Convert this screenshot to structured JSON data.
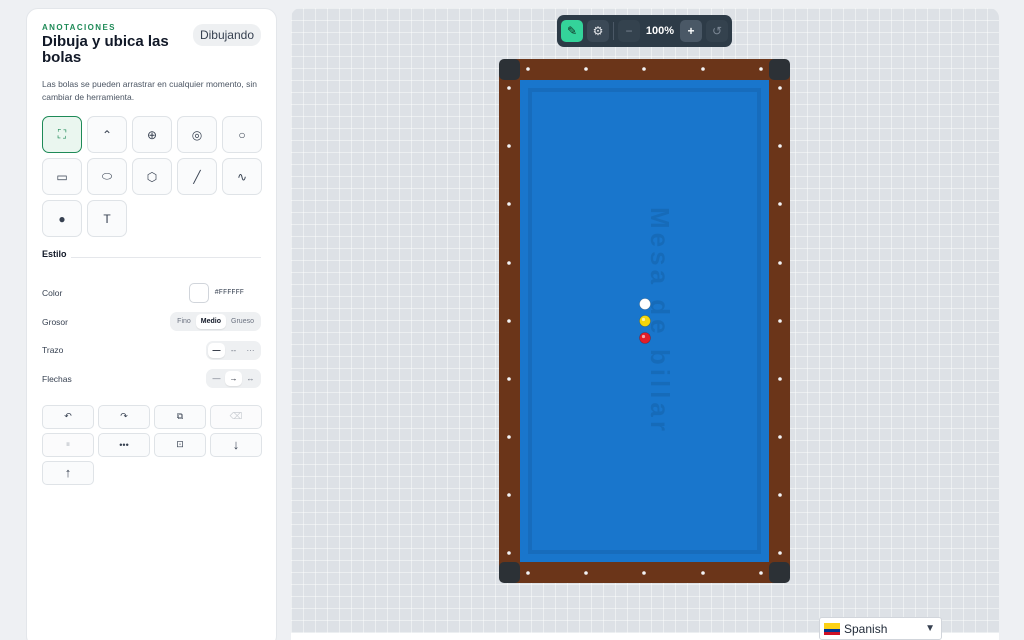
{
  "sidebar": {
    "eyebrow": "ANOTACIONES",
    "title": "Dibuja y ubica las bolas",
    "status": "Dibujando",
    "description": "Las bolas se pueden arrastrar en cualquier momento, sin cambiar de herramienta.",
    "tools": [
      {
        "name": "select-tool",
        "icon": "select-icon",
        "glyph": "⛶",
        "active": true
      },
      {
        "name": "path-tool",
        "icon": "trajectory-icon",
        "glyph": "⌃",
        "active": false
      },
      {
        "name": "target-tool",
        "icon": "target-icon",
        "glyph": "⊕",
        "active": false
      },
      {
        "name": "kiss-tool",
        "icon": "two-balls-icon",
        "glyph": "◎",
        "active": false
      },
      {
        "name": "circle-tool",
        "icon": "circle-icon",
        "glyph": "○",
        "active": false
      },
      {
        "name": "rectangle-tool",
        "icon": "rectangle-icon",
        "glyph": "▭",
        "active": false
      },
      {
        "name": "ellipse-tool",
        "icon": "ellipse-icon",
        "glyph": "⬭",
        "active": false
      },
      {
        "name": "polygon-tool",
        "icon": "hexagon-icon",
        "glyph": "⬡",
        "active": false
      },
      {
        "name": "line-tool",
        "icon": "line-icon",
        "glyph": "╱",
        "active": false
      },
      {
        "name": "freehand-tool",
        "icon": "wave-icon",
        "glyph": "∿",
        "active": false
      },
      {
        "name": "point-tool",
        "icon": "dot-icon",
        "glyph": "●",
        "active": false
      },
      {
        "name": "text-tool",
        "icon": "text-icon",
        "glyph": "T",
        "active": false
      }
    ],
    "style": {
      "heading": "Estilo",
      "color_label": "Color",
      "color_value": "#FFFFFF",
      "thickness_label": "Grosor",
      "thickness_options": [
        "Fino",
        "Medio",
        "Grueso"
      ],
      "thickness_selected": "Medio",
      "stroke_label": "Trazo",
      "stroke_options": [
        "—",
        "--",
        "···"
      ],
      "arrows_label": "Flechas",
      "arrow_options": [
        "—",
        "→",
        "↔"
      ]
    },
    "actions": [
      {
        "name": "undo-button",
        "icon": "undo-icon",
        "glyph": "↶",
        "disabled": false
      },
      {
        "name": "redo-button",
        "icon": "redo-icon",
        "glyph": "↷",
        "disabled": false
      },
      {
        "name": "duplicate-button",
        "icon": "duplicate-icon",
        "glyph": "⧉",
        "disabled": false
      },
      {
        "name": "delete-button",
        "icon": "erase-icon",
        "glyph": "⌫",
        "disabled": true
      },
      {
        "name": "pause-button",
        "icon": "pause-icon",
        "glyph": "⏸",
        "disabled": true
      },
      {
        "name": "more-button",
        "icon": "more-dots-icon",
        "glyph": "•••",
        "disabled": false
      },
      {
        "name": "screenshot-button",
        "icon": "camera-icon",
        "glyph": "⊡",
        "disabled": false
      },
      {
        "name": "download-button",
        "icon": "arrow-down-icon",
        "glyph": "↓",
        "disabled": false
      },
      {
        "name": "upload-button",
        "icon": "arrow-up-icon",
        "glyph": "↑",
        "disabled": false
      }
    ]
  },
  "toolbar": {
    "zoom": "100%",
    "minus": "−",
    "plus": "+"
  },
  "table": {
    "rail_color": "#6b3519",
    "cloth_color": "#1976cc",
    "watermark": "Mesa de billar",
    "balls": [
      {
        "name": "white-ball",
        "color": "#ffffff"
      },
      {
        "name": "yellow-ball",
        "color": "#f5d60a"
      },
      {
        "name": "red-ball",
        "color": "#e11d2a"
      }
    ]
  },
  "language": {
    "value": "Spanish"
  },
  "colors": {
    "accent": "#1e8a57",
    "toolbar_active": "#34d39a"
  }
}
